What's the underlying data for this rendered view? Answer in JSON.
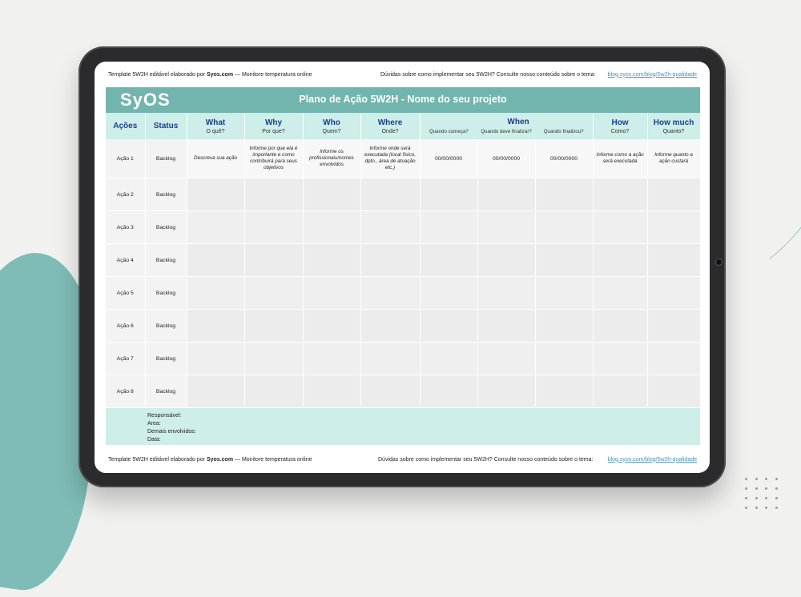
{
  "top_note": {
    "left_prefix": "Template 5W2H editável elaborado por",
    "left_brand": "Syos.com",
    "left_suffix": "— Monitore temperatura online",
    "middle": "Dúvidas sobre como implementar seu 5W2H? Consulte nosso conteúdo sobre o tema:",
    "link": "blog.syos.com/blog/5w2h-qualidade"
  },
  "bottom_note": {
    "left_prefix": "Template 5W2H editável elaborado por",
    "left_brand": "Syos.com",
    "left_suffix": "— Monitore temperatura online",
    "middle": "Dúvidas sobre como implementar seu 5W2H? Consulte nosso conteúdo sobre o tema:",
    "link": "blog.syos.com/blog/5w2h-qualidade"
  },
  "logo": "SyOS",
  "title": "Plano de Ação 5W2H - Nome do seu projeto",
  "headers": {
    "acoes": "Ações",
    "status": "Status",
    "what": "What",
    "what_sub": "O quê?",
    "why": "Why",
    "why_sub": "Por que?",
    "who": "Who",
    "who_sub": "Quem?",
    "where": "Where",
    "where_sub": "Onde?",
    "when": "When",
    "when_start": "Quando começa?",
    "when_finish": "Quando deve finalizar?",
    "when_done": "Quando finalizou?",
    "how": "How",
    "how_sub": "Como?",
    "howmuch": "How much",
    "howmuch_sub": "Quanto?"
  },
  "first_row": {
    "action": "Ação 1",
    "status": "Backlog",
    "what": "Descreva sua ação",
    "why": "Informe por que ela é importante e como contribuirá para seus objetivos",
    "who": "Informe os profissionais/nomes envolvidos",
    "where": "Informe onde será executada (local físico, dpto., área de atuação etc.)",
    "start": "00/00/0000",
    "finish": "00/00/0000",
    "done": "00/00/0000",
    "how": "Informe como a ação será executada",
    "howmuch": "Informe quanto a ação custará"
  },
  "rows": [
    {
      "action": "Ação 2",
      "status": "Backlog"
    },
    {
      "action": "Ação 3",
      "status": "Backlog"
    },
    {
      "action": "Ação 4",
      "status": "Backlog"
    },
    {
      "action": "Ação 5",
      "status": "Backlog"
    },
    {
      "action": "Ação 6",
      "status": "Backlog"
    },
    {
      "action": "Ação 7",
      "status": "Backlog"
    },
    {
      "action": "Ação 8",
      "status": "Backlog"
    }
  ],
  "footer": {
    "responsavel": "Responsável:",
    "area": "Area:",
    "envolvidos": "Demais envolvidos:",
    "data": "Data:"
  }
}
